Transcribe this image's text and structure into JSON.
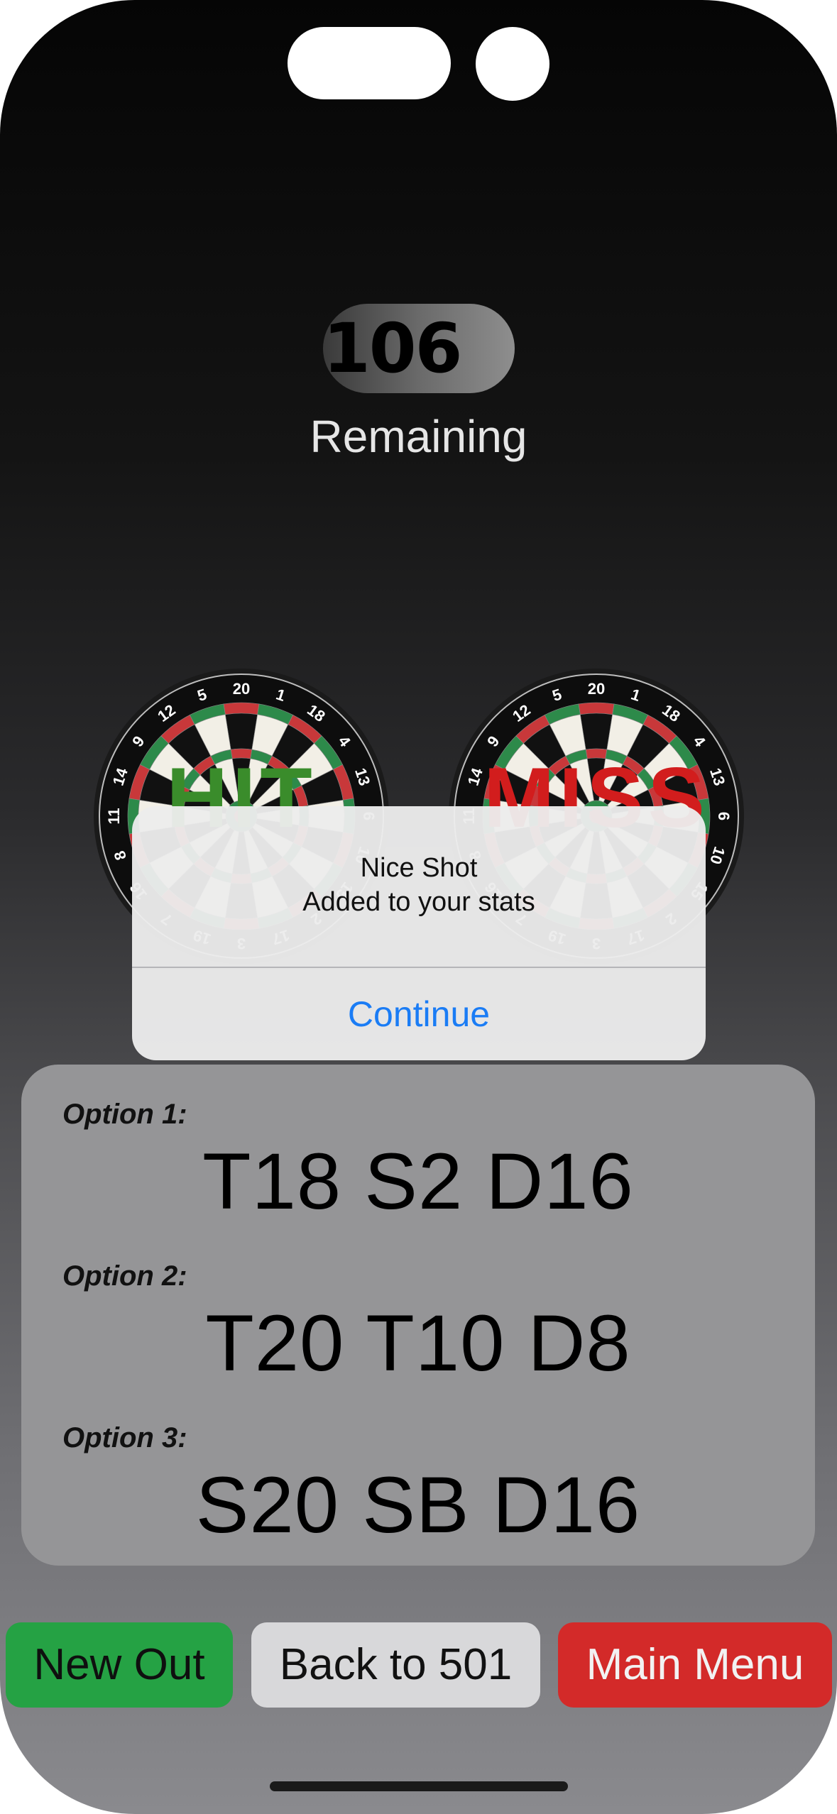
{
  "score": {
    "value": "106",
    "label": "Remaining"
  },
  "boards": {
    "left": {
      "label": "HIT",
      "color": "#3a8c2b"
    },
    "right": {
      "label": "MISS",
      "color": "#d21d1d"
    },
    "numbers": [
      "20",
      "1",
      "18",
      "4",
      "13",
      "6",
      "10",
      "15",
      "2",
      "17",
      "3",
      "19",
      "7",
      "16",
      "8",
      "11",
      "14",
      "9",
      "12",
      "5"
    ]
  },
  "alert": {
    "title": "Nice Shot",
    "message": "Added to your stats",
    "button": "Continue"
  },
  "options": [
    {
      "label": "Option 1:",
      "value": "T18 S2 D16"
    },
    {
      "label": "Option 2:",
      "value": "T20 T10 D8"
    },
    {
      "label": "Option 3:",
      "value": "S20 SB D16"
    }
  ],
  "buttons": {
    "new_out": "New Out",
    "back": "Back to 501",
    "main_menu": "Main Menu"
  },
  "colors": {
    "accent_blue": "#1a7cf5",
    "green": "#25a244",
    "red": "#d32a29"
  }
}
